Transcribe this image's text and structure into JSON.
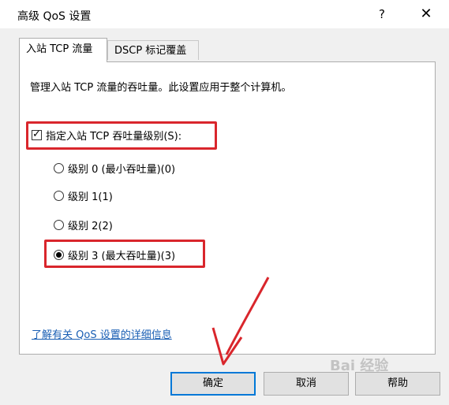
{
  "window": {
    "title": "高级 QoS 设置",
    "help_glyph": "?",
    "close_glyph": "✕"
  },
  "tabs": [
    {
      "label": "入站 TCP 流量",
      "active": true
    },
    {
      "label": "DSCP 标记覆盖",
      "active": false
    }
  ],
  "panel": {
    "description": "管理入站 TCP 流量的吞吐量。此设置应用于整个计算机。",
    "checkbox": {
      "label": "指定入站 TCP 吞吐量级别(S):",
      "checked": true
    },
    "radios": [
      {
        "label": "级别 0 (最小吞吐量)(0)",
        "selected": false
      },
      {
        "label": "级别 1(1)",
        "selected": false
      },
      {
        "label": "级别 2(2)",
        "selected": false
      },
      {
        "label": "级别 3 (最大吞吐量)(3)",
        "selected": true
      }
    ],
    "link": "了解有关 QoS 设置的详细信息"
  },
  "buttons": {
    "ok": "确定",
    "cancel": "取消",
    "help": "帮助"
  },
  "annotation": {
    "color": "#d9262c"
  },
  "watermark": "Bai 经验"
}
